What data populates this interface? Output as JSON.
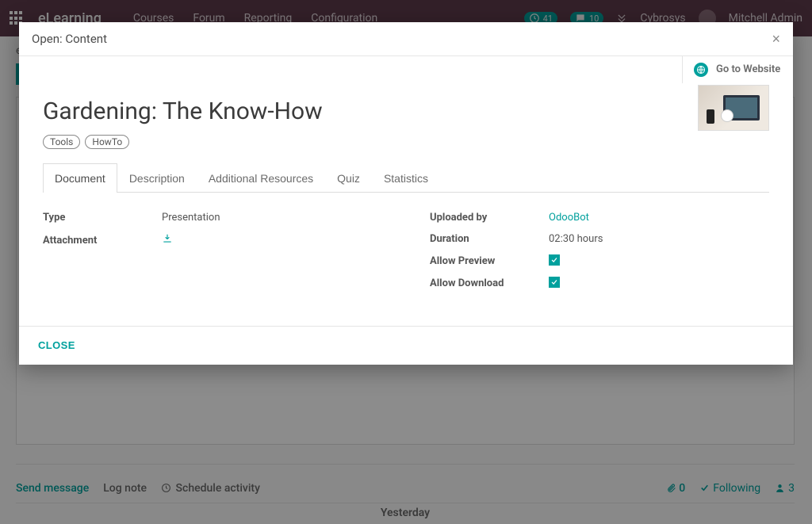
{
  "navbar": {
    "brand": "eLearning",
    "menu": [
      "Courses",
      "Forum",
      "Reporting",
      "Configuration"
    ],
    "activities_badge": "41",
    "messages_badge": "10",
    "company": "Cybrosys",
    "user": "Mitchell Admin"
  },
  "background": {
    "breadcrumb_prefix": "e",
    "new_button": "NEW",
    "chatter": {
      "send_message": "Send message",
      "log_note": "Log note",
      "schedule_activity": "Schedule activity",
      "attachments_count": "0",
      "following": "Following",
      "followers_count": "3"
    },
    "separator": "Yesterday"
  },
  "modal": {
    "title": "Open: Content",
    "go_to_website": "Go to Website",
    "record_title": "Gardening: The Know-How",
    "tags": [
      "Tools",
      "HowTo"
    ],
    "tabs": [
      "Document",
      "Description",
      "Additional Resources",
      "Quiz",
      "Statistics"
    ],
    "active_tab_index": 0,
    "fields_left": [
      {
        "label": "Type",
        "value": "Presentation"
      },
      {
        "label": "Attachment",
        "value": "download-icon"
      }
    ],
    "fields_right": [
      {
        "label": "Uploaded by",
        "value": "OdooBot",
        "link": true
      },
      {
        "label": "Duration",
        "value": "02:30 hours"
      },
      {
        "label": "Allow Preview",
        "value": "checked"
      },
      {
        "label": "Allow Download",
        "value": "checked"
      }
    ],
    "close_button": "CLOSE"
  }
}
